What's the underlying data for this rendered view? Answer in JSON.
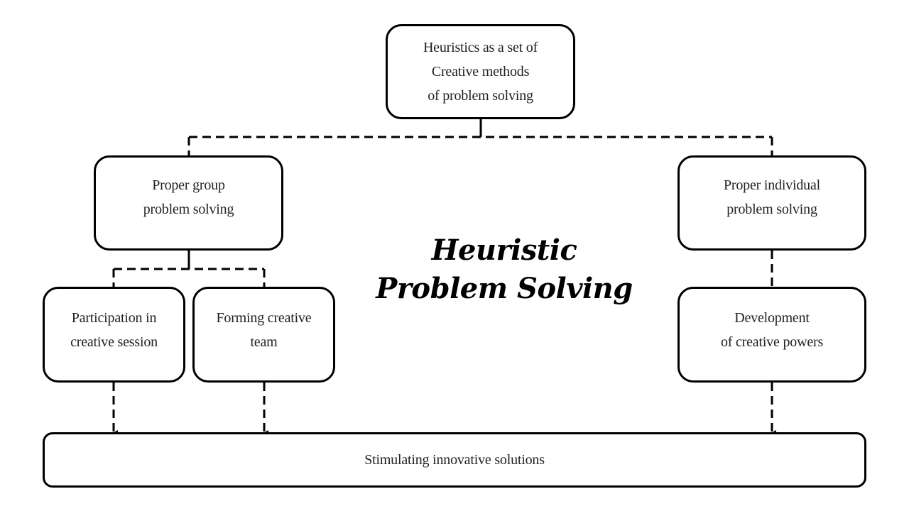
{
  "diagram": {
    "title": "Heuristic\nProblem Solving",
    "nodes": {
      "root": "Heuristics as a set of\nCreative methods\nof problem solving",
      "group": "Proper group\nproblem solving",
      "individual": "Proper individual\nproblem solving",
      "participation": "Participation in\ncreative session",
      "team": "Forming creative\nteam",
      "development": "Development\nof creative powers",
      "outcome": "Stimulating innovative solutions"
    },
    "edges": [
      {
        "from": "root",
        "to": "group",
        "style": "dashed"
      },
      {
        "from": "root",
        "to": "individual",
        "style": "dashed"
      },
      {
        "from": "group",
        "to": "participation",
        "style": "dashed"
      },
      {
        "from": "group",
        "to": "team",
        "style": "dashed"
      },
      {
        "from": "individual",
        "to": "development",
        "style": "dashed"
      },
      {
        "from": "participation",
        "to": "outcome",
        "style": "dashed-arrow"
      },
      {
        "from": "team",
        "to": "outcome",
        "style": "dashed-arrow"
      },
      {
        "from": "development",
        "to": "outcome",
        "style": "dashed-arrow"
      }
    ],
    "colors": {
      "stroke": "#000000",
      "text": "#222222",
      "background": "#ffffff"
    }
  }
}
